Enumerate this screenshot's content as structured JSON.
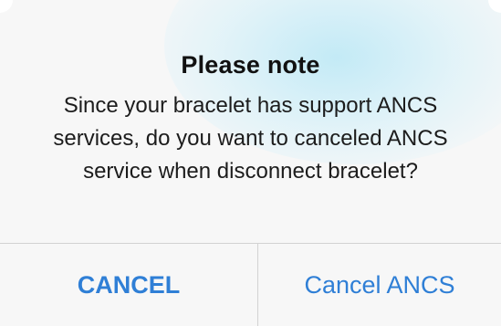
{
  "alert": {
    "title": "Please note",
    "message": "Since your bracelet has support ANCS services, do you want to canceled ANCS service when disconnect bracelet?",
    "buttons": {
      "cancel_label": "CANCEL",
      "confirm_label": "Cancel ANCS"
    }
  },
  "colors": {
    "button_text": "#2f7fd6",
    "title_text": "#111111",
    "divider": "#d2d2d2",
    "background": "#f7f7f7"
  }
}
